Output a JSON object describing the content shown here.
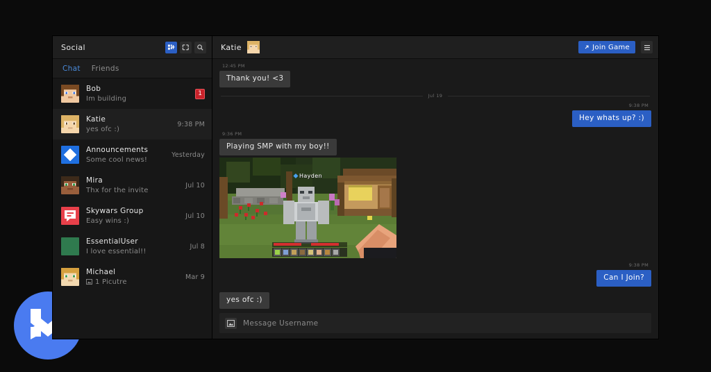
{
  "window": {
    "sidebar": {
      "title": "Social",
      "header_icons": [
        {
          "name": "add-friend-icon",
          "label": "Add Friend",
          "active": true
        },
        {
          "name": "new-group-icon",
          "label": "New Group",
          "active": false
        },
        {
          "name": "search-icon",
          "label": "Search",
          "active": false
        }
      ],
      "tabs": [
        {
          "label": "Chat",
          "selected": true
        },
        {
          "label": "Friends",
          "selected": false
        }
      ],
      "chats": [
        {
          "name": "Bob",
          "preview": "Im building",
          "time": "",
          "badge": "1",
          "selected": false,
          "avatar": "bob"
        },
        {
          "name": "Katie",
          "preview": "yes ofc :)",
          "time": "9:38 PM",
          "badge": "",
          "selected": true,
          "avatar": "katie"
        },
        {
          "name": "Announcements",
          "preview": "Some cool news!",
          "time": "Yesterday",
          "badge": "",
          "selected": false,
          "avatar": "announcements"
        },
        {
          "name": "Mira",
          "preview": "Thx for the invite",
          "time": "Jul 10",
          "badge": "",
          "selected": false,
          "avatar": "mira"
        },
        {
          "name": "Skywars Group",
          "preview": "Easy wins :)",
          "time": "Jul 10",
          "badge": "",
          "selected": false,
          "avatar": "skywars"
        },
        {
          "name": "EssentialUser",
          "preview": "I love essential!!",
          "time": "Jul 8",
          "badge": "",
          "selected": false,
          "avatar": "essentialuser"
        },
        {
          "name": "Michael",
          "preview": "1 Picutre",
          "time": "Mar 9",
          "badge": "",
          "selected": false,
          "avatar": "michael",
          "preview_icon": "image-icon"
        }
      ]
    },
    "chat": {
      "title": "Katie",
      "join_button": {
        "label": "Join Game",
        "icon": "arrow-up-right-icon"
      },
      "menu_button": {
        "icon": "hamburger-menu-icon"
      },
      "divider_label": "Jul 19",
      "messages": [
        {
          "side": "them",
          "time": "12:45 PM",
          "text": "Thank you! <3",
          "type": "text"
        },
        {
          "side": "me",
          "time": "9:38 PM",
          "text": "Hey whats up? :)",
          "type": "text"
        },
        {
          "side": "them",
          "time": "9:36 PM",
          "text": "Playing SMP with my boy!!",
          "type": "text"
        },
        {
          "side": "them",
          "time": "",
          "text": "",
          "type": "image",
          "image_nametag": "Hayden"
        },
        {
          "side": "me",
          "time": "9:38 PM",
          "text": "Can I Join?",
          "type": "text"
        },
        {
          "side": "them",
          "time": "",
          "text": "yes ofc :)",
          "type": "text"
        }
      ],
      "composer": {
        "placeholder": "Message Username",
        "icon": "image-attach-icon"
      }
    }
  },
  "branding": {
    "logo": "essential-logo",
    "logo_color": "#4a7bf0"
  },
  "colors": {
    "accent_blue": "#2b5fc4",
    "tab_blue": "#4a8bdb",
    "badge_red": "#c9222a",
    "bubble_them": "#3a3a3a",
    "panel_bg": "#171717",
    "chat_bg": "#1a1a1a"
  }
}
